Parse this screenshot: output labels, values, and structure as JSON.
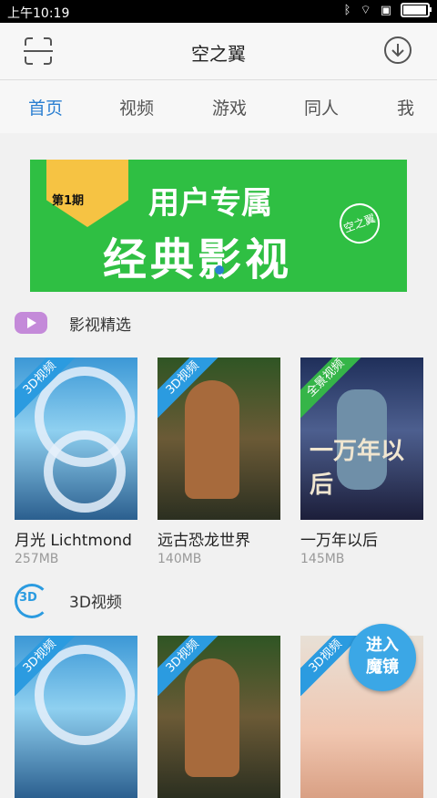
{
  "status": {
    "time": "上午10:19",
    "icons": [
      "bluetooth-icon",
      "wifi-icon",
      "sim-icon",
      "battery-icon"
    ],
    "battery_level": 0.9
  },
  "header": {
    "title": "空之翼"
  },
  "tabs": [
    {
      "label": "首页",
      "active": true
    },
    {
      "label": "视频",
      "active": false
    },
    {
      "label": "游戏",
      "active": false
    },
    {
      "label": "同人",
      "active": false
    },
    {
      "label": "我",
      "active": false
    }
  ],
  "banner": {
    "tag": "第1期",
    "title1": "用户专属",
    "title2": "经典影视",
    "mark": "空之翼"
  },
  "sections": [
    {
      "label": "影视精选",
      "items": [
        {
          "name": "月光 Lichtmond",
          "size": "257MB",
          "badge": "3D视频"
        },
        {
          "name": "远古恐龙世界",
          "size": "140MB",
          "badge": "3D视频"
        },
        {
          "name": "一万年以后",
          "size": "145MB",
          "badge": "全景视频",
          "poster_title": "一万年以后"
        }
      ]
    },
    {
      "label": "3D视频",
      "items": [
        {
          "badge": "3D视频"
        },
        {
          "badge": "3D视频"
        },
        {
          "badge": "3D视频"
        }
      ]
    }
  ],
  "vr_button": {
    "line1": "进入",
    "line2": "魔镜"
  },
  "colors": {
    "accent": "#2b7fd1",
    "badge_blue": "#2b9be0",
    "badge_green": "#35b548",
    "section_icon": "#c48ad9"
  }
}
